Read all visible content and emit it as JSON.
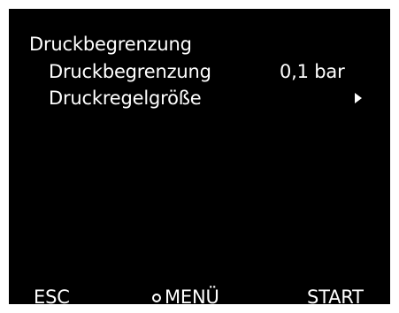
{
  "menu": {
    "title": "Druckbegrenzung",
    "items": [
      {
        "label": "Druckbegrenzung",
        "value": "0,1 bar"
      },
      {
        "label": "Druckregelgröße",
        "submenu_icon": "triangle-right-icon"
      }
    ]
  },
  "softkeys": {
    "left": "ESC",
    "center": "MENÜ",
    "center_icon": "ring-icon",
    "right": "START"
  },
  "colors": {
    "background": "#000000",
    "text": "#ffffff"
  }
}
